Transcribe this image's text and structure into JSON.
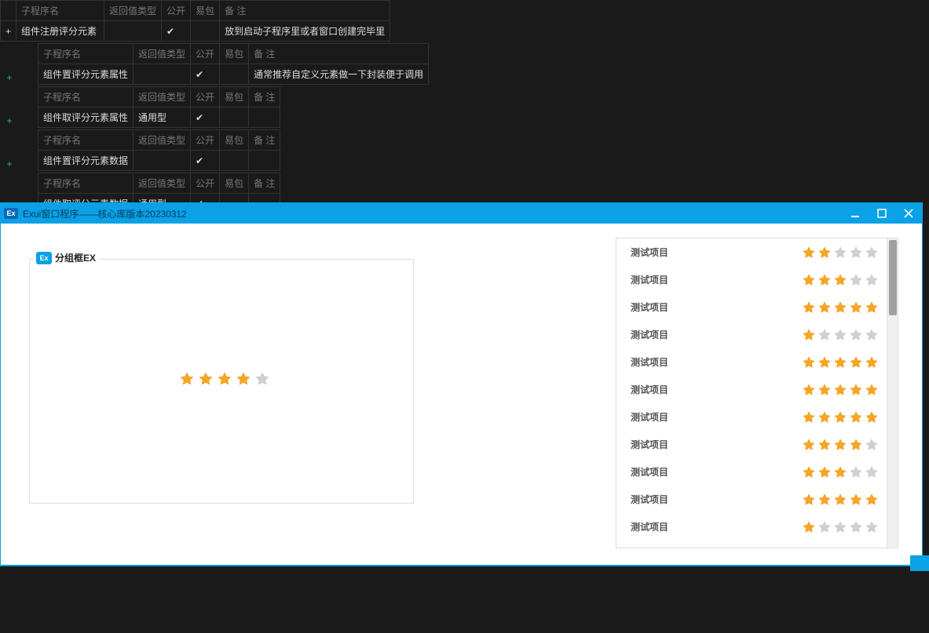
{
  "editor": {
    "headers": {
      "sub_name": "子程序名",
      "return_type": "返回值类型",
      "public": "公开",
      "easy_pack": "易包",
      "remark": "备 注"
    },
    "rows": [
      {
        "name": "组件注册评分元素",
        "return_type": "",
        "public": true,
        "remark": "放到启动子程序里或者窗口创建完毕里",
        "remark_style": "green"
      },
      {
        "name": "组件置评分元素属性",
        "return_type": "",
        "public": true,
        "remark": "通常推荐自定义元素做一下封装便于调用",
        "remark_style": "green"
      },
      {
        "name": "组件取评分元素属性",
        "return_type": "通用型",
        "public": true,
        "remark": "",
        "remark_style": ""
      },
      {
        "name": "组件置评分元素数据",
        "return_type": "",
        "public": true,
        "remark": "",
        "remark_style": ""
      },
      {
        "name": "组件取评分元素数据",
        "return_type": "通用型",
        "public": true,
        "remark": "",
        "remark_style": ""
      }
    ]
  },
  "window": {
    "title": "Exui窗口程序——核心库版本20230312",
    "logo_text": "Ex"
  },
  "groupbox": {
    "logo_text": "Ex",
    "title": "分组框EX",
    "rating": 4,
    "max_rating": 5
  },
  "list": {
    "items": [
      {
        "label": "测试项目",
        "rating": 2
      },
      {
        "label": "测试项目",
        "rating": 3
      },
      {
        "label": "测试项目",
        "rating": 5
      },
      {
        "label": "测试项目",
        "rating": 1
      },
      {
        "label": "测试项目",
        "rating": 5
      },
      {
        "label": "测试项目",
        "rating": 5
      },
      {
        "label": "测试项目",
        "rating": 5
      },
      {
        "label": "测试项目",
        "rating": 4
      },
      {
        "label": "测试项目",
        "rating": 3
      },
      {
        "label": "测试项目",
        "rating": 5
      },
      {
        "label": "测试项目",
        "rating": 1
      }
    ],
    "max_rating": 5
  }
}
